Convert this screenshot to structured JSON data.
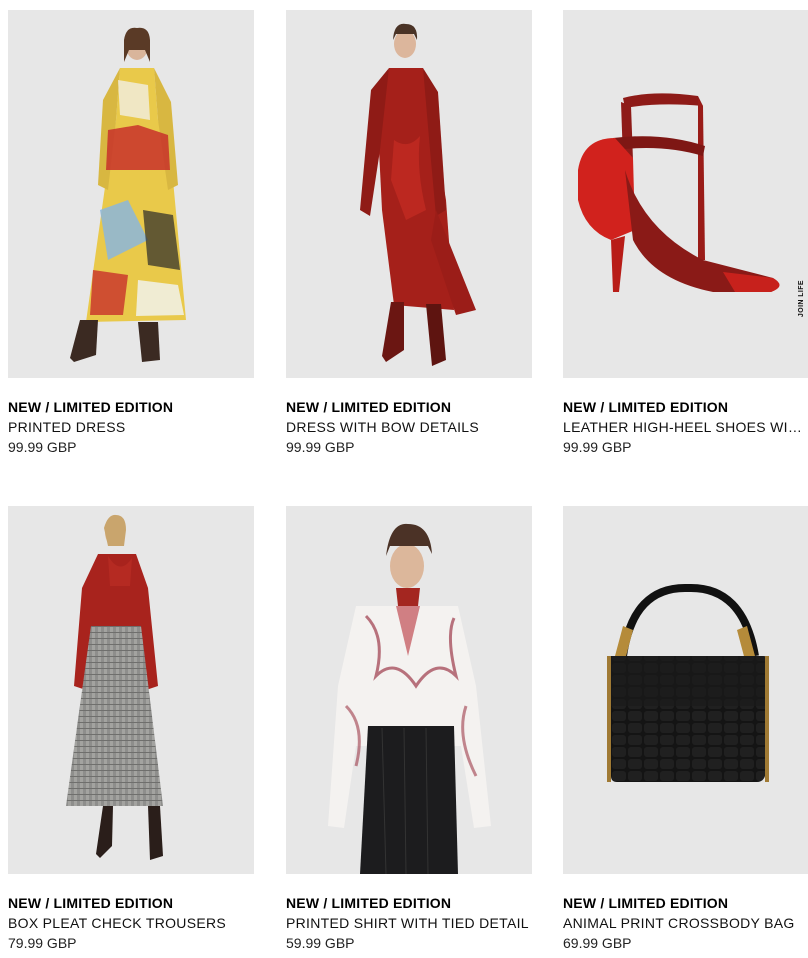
{
  "products": [
    {
      "tag": "NEW / LIMITED EDITION",
      "title": "PRINTED DRESS",
      "price": "99.99 GBP",
      "image": "model-printed-dress-photo"
    },
    {
      "tag": "NEW / LIMITED EDITION",
      "title": "DRESS WITH BOW DETAILS",
      "price": "99.99 GBP",
      "image": "model-red-satin-dress-photo"
    },
    {
      "tag": "NEW / LIMITED EDITION",
      "title": "LEATHER HIGH-HEEL SHOES WIT…",
      "price": "99.99 GBP",
      "image": "red-high-heel-shoe-photo",
      "badge": "JOIN LIFE"
    },
    {
      "tag": "NEW / LIMITED EDITION",
      "title": "BOX PLEAT CHECK TROUSERS",
      "price": "79.99 GBP",
      "image": "model-check-trousers-photo"
    },
    {
      "tag": "NEW / LIMITED EDITION",
      "title": "PRINTED SHIRT WITH TIED DETAIL",
      "price": "59.99 GBP",
      "image": "model-printed-shirt-photo"
    },
    {
      "tag": "NEW / LIMITED EDITION",
      "title": "ANIMAL PRINT CROSSBODY BAG",
      "price": "69.99 GBP",
      "image": "black-croc-bag-photo"
    }
  ],
  "colors": {
    "background": "#ffffff",
    "image_bg": "#e7e7e7",
    "text": "#000000"
  }
}
